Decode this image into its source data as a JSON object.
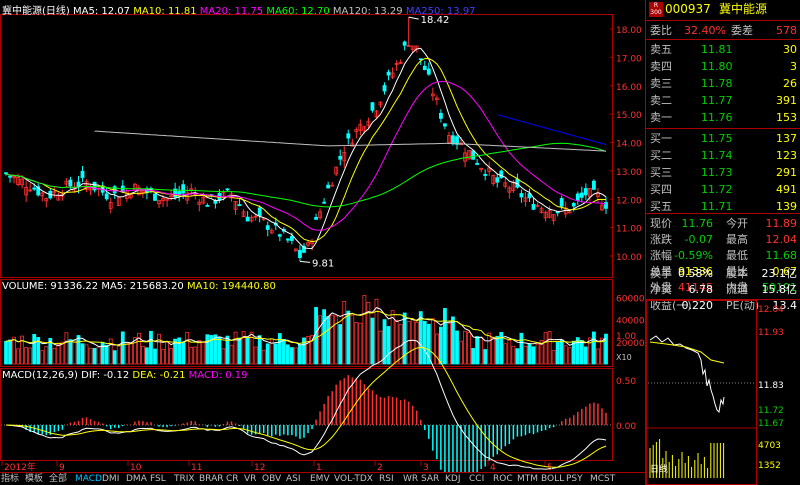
{
  "header": {
    "stock_name": "冀中能源(日线)",
    "ma5": "MA5: 12.07",
    "ma10": "MA10: 11.81",
    "ma20": "MA20: 11.75",
    "ma60": "MA60: 12.70",
    "ma120": "MA120: 13.29",
    "ma250": "MA250: 13.97"
  },
  "price_axis": [
    "18.00",
    "17.00",
    "16.00",
    "15.00",
    "14.00",
    "13.00",
    "12.00",
    "11.00",
    "10.00"
  ],
  "high_label": "18.42",
  "low_label": "9.81",
  "volume": {
    "title": "VOLUME: 91336.22",
    "ma5": "MA5: 215683.20",
    "ma10": "MA10: 194440.80",
    "axis": [
      "60000",
      "40000",
      "20000"
    ],
    "unit": "X10"
  },
  "macd": {
    "title": "MACD(12,26,9)",
    "dif": "DIF: -0.12",
    "dea": "DEA: -0.21",
    "macd": "MACD: 0.19",
    "axis": [
      "1.00",
      "0.50",
      "0.00"
    ]
  },
  "date_axis": [
    "2012年",
    "9",
    "10",
    "11",
    "12",
    "1",
    "2",
    "3",
    "4",
    "5"
  ],
  "tabs": [
    "指标",
    "模板",
    "全部",
    "MACD",
    "DMI",
    "DMA",
    "FSL",
    "TRIX",
    "BRAR",
    "CR",
    "VR",
    "OBV",
    "ASI",
    "EMV",
    "VOL-TDX",
    "RSI",
    "WR",
    "SAR",
    "KDJ",
    "CCI",
    "ROC",
    "MTM",
    "BOLL",
    "PSY",
    "MCST"
  ],
  "active_tab": "MACD",
  "panel": {
    "code": "000937",
    "name": "冀中能源",
    "badge_top": "R",
    "badge_bottom": "300",
    "wei_bi_label": "委比",
    "wei_bi": "32.40%",
    "wei_cha_label": "委差",
    "wei_cha": "578",
    "sell": [
      {
        "label": "卖五",
        "price": "11.81",
        "vol": "30"
      },
      {
        "label": "卖四",
        "price": "11.80",
        "vol": "3"
      },
      {
        "label": "卖三",
        "price": "11.78",
        "vol": "26"
      },
      {
        "label": "卖二",
        "price": "11.77",
        "vol": "391"
      },
      {
        "label": "卖一",
        "price": "11.76",
        "vol": "153"
      }
    ],
    "buy": [
      {
        "label": "买一",
        "price": "11.75",
        "vol": "137"
      },
      {
        "label": "买二",
        "price": "11.74",
        "vol": "123"
      },
      {
        "label": "买三",
        "price": "11.73",
        "vol": "291"
      },
      {
        "label": "买四",
        "price": "11.72",
        "vol": "491"
      },
      {
        "label": "买五",
        "price": "11.71",
        "vol": "139"
      }
    ],
    "quote": [
      {
        "l1": "现价",
        "v1": "11.76",
        "l2": "今开",
        "v2": "11.89",
        "c1": "#00d000",
        "c2": "#ff3030"
      },
      {
        "l1": "涨跌",
        "v1": "-0.07",
        "l2": "最高",
        "v2": "12.04",
        "c1": "#00d000",
        "c2": "#ff3030"
      },
      {
        "l1": "涨幅",
        "v1": "-0.59%",
        "l2": "最低",
        "v2": "11.68",
        "c1": "#00d000",
        "c2": "#00d000"
      },
      {
        "l1": "总量",
        "v1": "91336",
        "l2": "量比",
        "v2": "0.67",
        "c1": "#ffff00",
        "c2": "#ffff00"
      },
      {
        "l1": "外盘",
        "v1": "41145",
        "l2": "内盘",
        "v2": "50191",
        "c1": "#ff3030",
        "c2": "#00d000"
      }
    ],
    "stats": [
      {
        "l1": "换手",
        "v1": "0.58%",
        "l2": "股本",
        "v2": "23.1亿"
      },
      {
        "l1": "净资",
        "v1": "6.78",
        "l2": "流通",
        "v2": "15.8亿"
      },
      {
        "l1": "收益(一)",
        "v1": "0.220",
        "l2": "PE(动)",
        "v2": "13.4"
      }
    ],
    "mini_axis": [
      "12.04",
      "11.93",
      "11.83",
      "11.72",
      "11.67"
    ],
    "mini_vol_axis": [
      "4703",
      "1352"
    ],
    "mini_label": "日线"
  },
  "colors": {
    "up": "#ff3030",
    "down": "#00ffff",
    "ma5": "#ffffff",
    "ma10": "#ffff00",
    "ma20": "#ff00ff",
    "ma60": "#00ff00",
    "ma120": "#c0c0c0",
    "ma250": "#0000ff",
    "border": "#aa0000"
  }
}
